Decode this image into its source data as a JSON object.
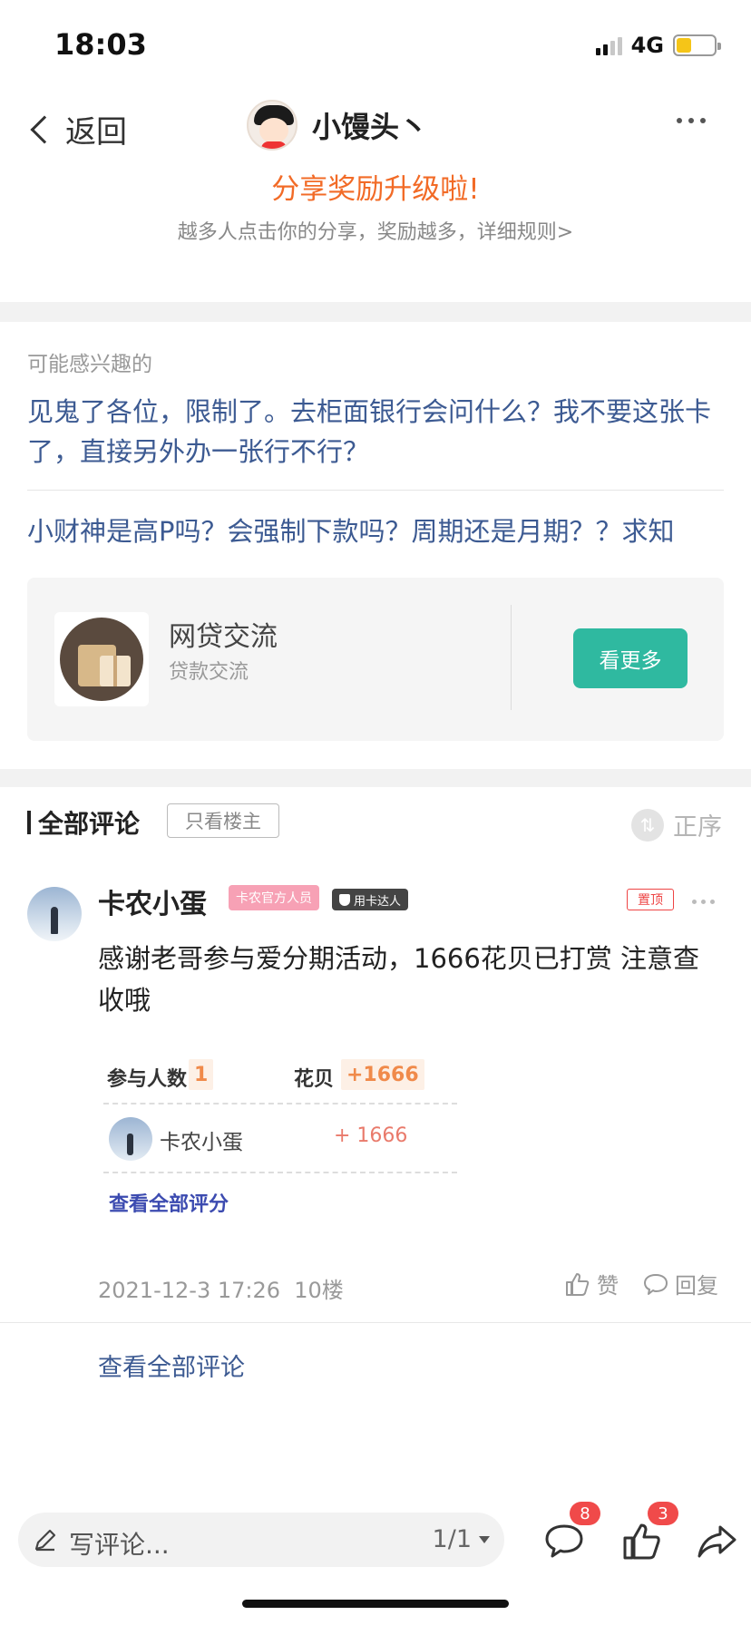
{
  "status_bar": {
    "time": "18:03",
    "network": "4G",
    "signal_bars": [
      true,
      true,
      false,
      false
    ],
    "battery_level": 0.4,
    "battery_color": "#f5c518"
  },
  "nav": {
    "back_label": "返回",
    "title": "小馒头丶"
  },
  "share_banner": {
    "title": "分享奖励升级啦!",
    "subtitle": "越多人点击你的分享，奖励越多，详细规则>"
  },
  "interested": {
    "label": "可能感兴趣的",
    "posts": [
      "见鬼了各位，限制了。去柜面银行会问什么？我不要这张卡了，直接另外办一张行不行？",
      "小财神是高P吗？会强制下款吗？周期还是月期？？求知"
    ],
    "forum": {
      "name": "网贷交流",
      "desc": "贷款交流",
      "button": "看更多"
    }
  },
  "comments": {
    "title": "全部评论",
    "op_only": "只看楼主",
    "sort_label": "正序",
    "items": [
      {
        "username": "卡农小蛋",
        "badge_official": "卡农官方人员",
        "badge_expert": "用卡达人",
        "pin": "置顶",
        "text": "感谢老哥参与爱分期活动，1666花贝已打赏  注意查收哦",
        "reward": {
          "participants_label": "参与人数",
          "participants_value": "1",
          "huabei_label": "花贝",
          "huabei_value": "+1666",
          "row_name": "卡农小蛋",
          "row_amount": "+ 1666",
          "link": "查看全部评分"
        },
        "datetime": "2021-12-3 17:26",
        "floor": "10楼",
        "like_label": "赞",
        "reply_label": "回复"
      }
    ],
    "view_all": "查看全部评论"
  },
  "bottom_bar": {
    "compose_placeholder": "写评论...",
    "page_indicator": "1/1",
    "comment_count": "8",
    "like_count": "3"
  },
  "colors": {
    "accent_link": "#3c5a92",
    "share_orange": "#f26b27",
    "button_green": "#2fb9a0",
    "badge_red": "#f04a4a"
  }
}
